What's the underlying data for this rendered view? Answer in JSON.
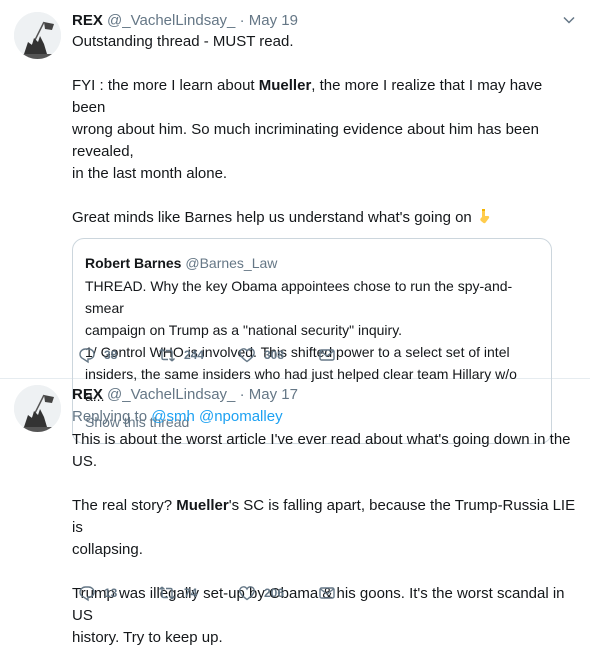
{
  "tweets": [
    {
      "name": "REX",
      "handle": "@_VachelLindsay_",
      "separator": "·",
      "date": "May 19",
      "paragraphs": [
        [
          "Outstanding thread - MUST read."
        ],
        [
          "FYI : the more I learn about ",
          "Mueller",
          ", the more I realize that I may have been",
          "wrong about him. So much incriminating evidence about him has been revealed,",
          "in the last month alone."
        ],
        [
          "Great minds like Barnes help us understand what's going on"
        ]
      ],
      "emoji": "point-down-emoji",
      "quote": {
        "name": "Robert Barnes",
        "handle": "@Barnes_Law",
        "lines": [
          "THREAD. Why the key Obama appointees chose to run the spy-and-smear",
          "campaign on Trump as a \"national security\" inquiry.",
          "1/ Control WHO is involved. This shifted power to a select set of intel",
          "insiders, the same insiders who had just helped clear team Hillary w/o a..."
        ],
        "show_thread": "Show this thread"
      },
      "actions": {
        "replies": "38",
        "retweets": "244",
        "likes": "308"
      }
    },
    {
      "name": "REX",
      "handle": "@_VachelLindsay_",
      "separator": "·",
      "date": "May 17",
      "replying_prefix": "Replying to ",
      "replying_to": [
        "@smh",
        "@npomalley"
      ],
      "p1": "This is about the worst article I've ever read about what's going down in the US.",
      "p2_pre": "The real story? ",
      "p2_bold": "Mueller",
      "p2_post": "'s SC is falling apart, because the Trump-Russia LIE is",
      "p2_line2": "collapsing.",
      "p3_line1": "Trump was illegally set-up by Obama & his goons. It's the worst scandal in US",
      "p3_line2": "history. Try to keep up.",
      "actions": {
        "replies": "13",
        "retweets": "74",
        "likes": "206"
      }
    }
  ],
  "colors": {
    "text": "#14171a",
    "secondary": "#657786",
    "link": "#1da1f2",
    "border": "#e6ecf0"
  }
}
